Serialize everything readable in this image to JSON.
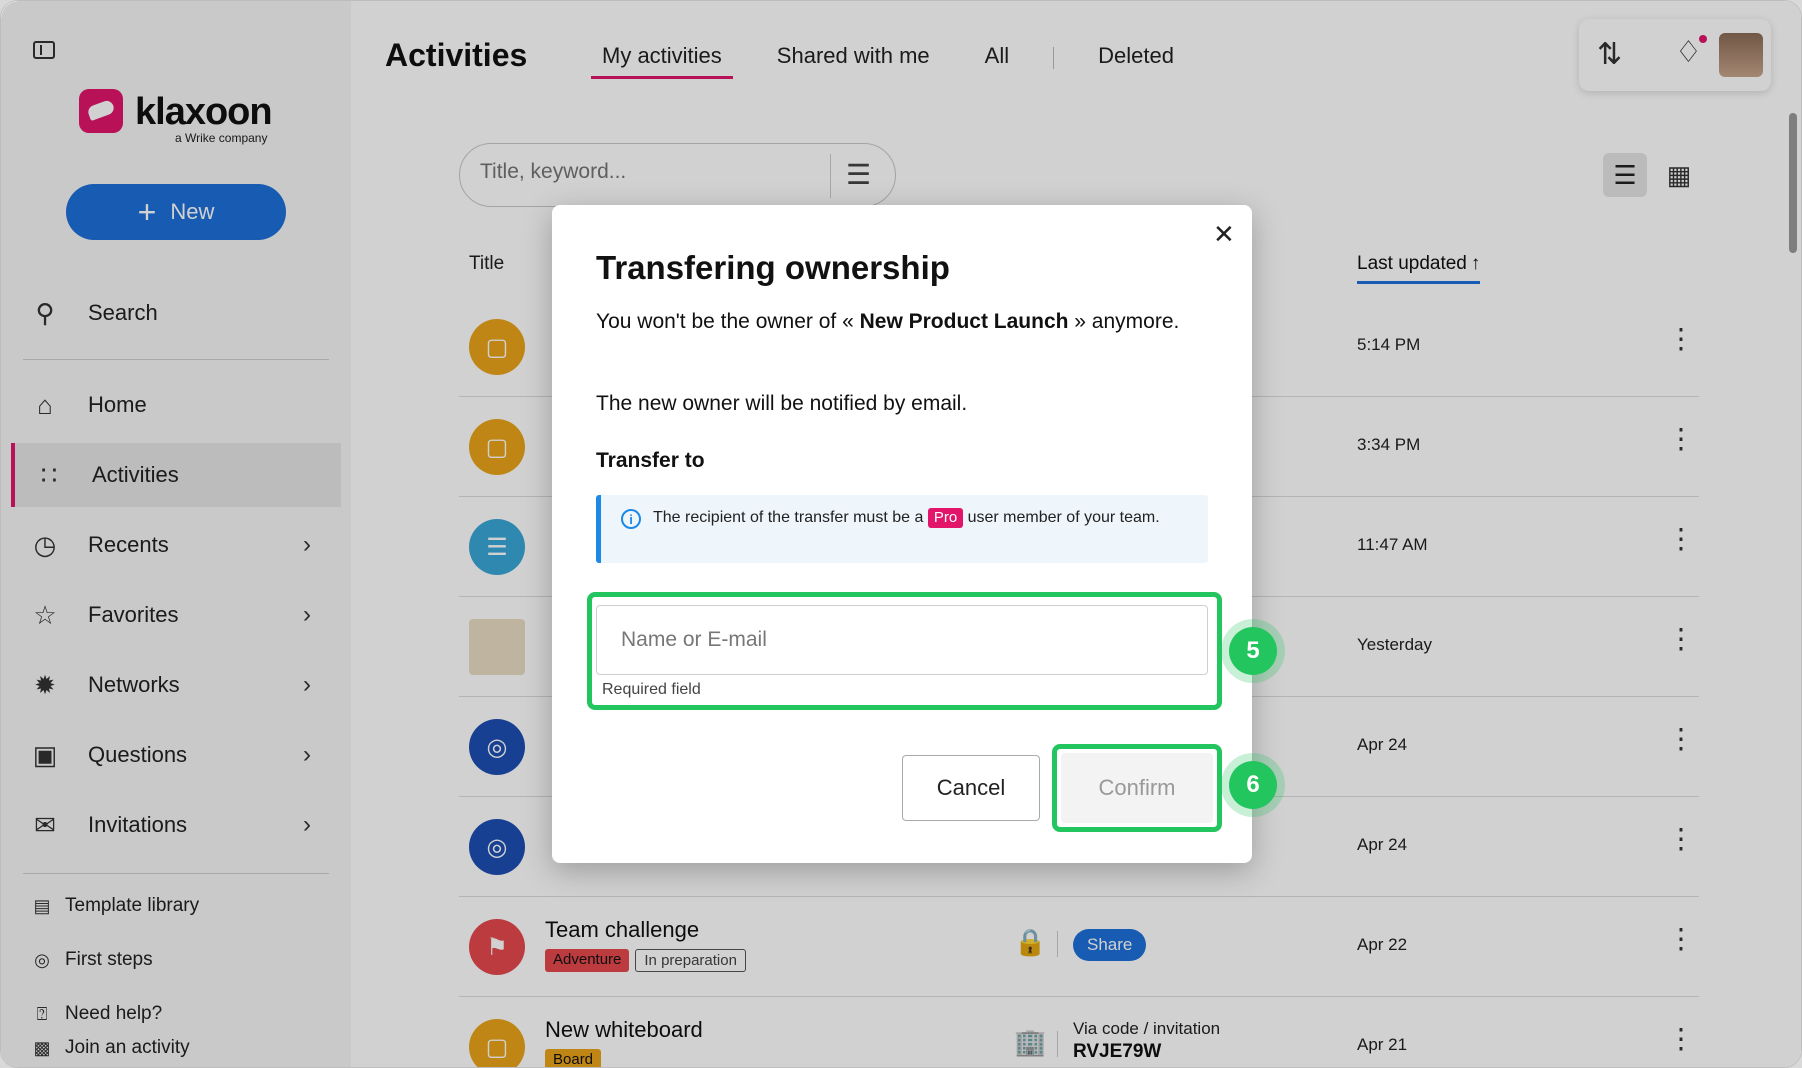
{
  "sidebar": {
    "logo": {
      "word": "klaxoon",
      "sub": "a Wrike company"
    },
    "new_label": "New",
    "search_label": "Search",
    "items": [
      {
        "label": "Home"
      },
      {
        "label": "Activities"
      },
      {
        "label": "Recents"
      },
      {
        "label": "Favorites"
      },
      {
        "label": "Networks"
      },
      {
        "label": "Questions"
      },
      {
        "label": "Invitations"
      }
    ],
    "links": [
      {
        "label": "Template library"
      },
      {
        "label": "First steps"
      },
      {
        "label": "Need help?"
      },
      {
        "label": "Join an activity"
      }
    ]
  },
  "header": {
    "title": "Activities",
    "tabs": [
      {
        "label": "My activities"
      },
      {
        "label": "Shared with me"
      },
      {
        "label": "All"
      },
      {
        "label": "Deleted"
      }
    ]
  },
  "search": {
    "placeholder": "Title, keyword..."
  },
  "table": {
    "col_title": "Title",
    "col_updated": "Last updated",
    "rows": [
      {
        "time": "5:14 PM"
      },
      {
        "time": "3:34 PM"
      },
      {
        "time": "11:47 AM"
      },
      {
        "time": "Yesterday"
      },
      {
        "time": "Apr 24"
      },
      {
        "time": "Apr 24"
      },
      {
        "name": "Team challenge",
        "tag1": "Adventure",
        "tag2": "In preparation",
        "share": "Share",
        "time": "Apr 22"
      },
      {
        "name": "New whiteboard",
        "tag1": "Board",
        "via": "Via code / invitation",
        "code": "RVJE79W",
        "time": "Apr 21"
      }
    ]
  },
  "modal": {
    "title": "Transfering ownership",
    "text_prefix": "You won't be the owner of « ",
    "activity_name": "New Product Launch",
    "text_suffix": " » anymore.",
    "notice": "The new owner will be notified by email.",
    "transfer_label": "Transfer to",
    "info_prefix": "The recipient of the transfer must be a",
    "info_badge": "Pro",
    "info_suffix": "user member of your team.",
    "input_placeholder": "Name or E-mail",
    "required": "Required field",
    "cancel": "Cancel",
    "confirm": "Confirm"
  },
  "steps": {
    "first": "5",
    "second": "6"
  },
  "colors": {
    "accent": "#e2156b",
    "primary": "#1e6fd9",
    "highlight": "#22c55e"
  }
}
